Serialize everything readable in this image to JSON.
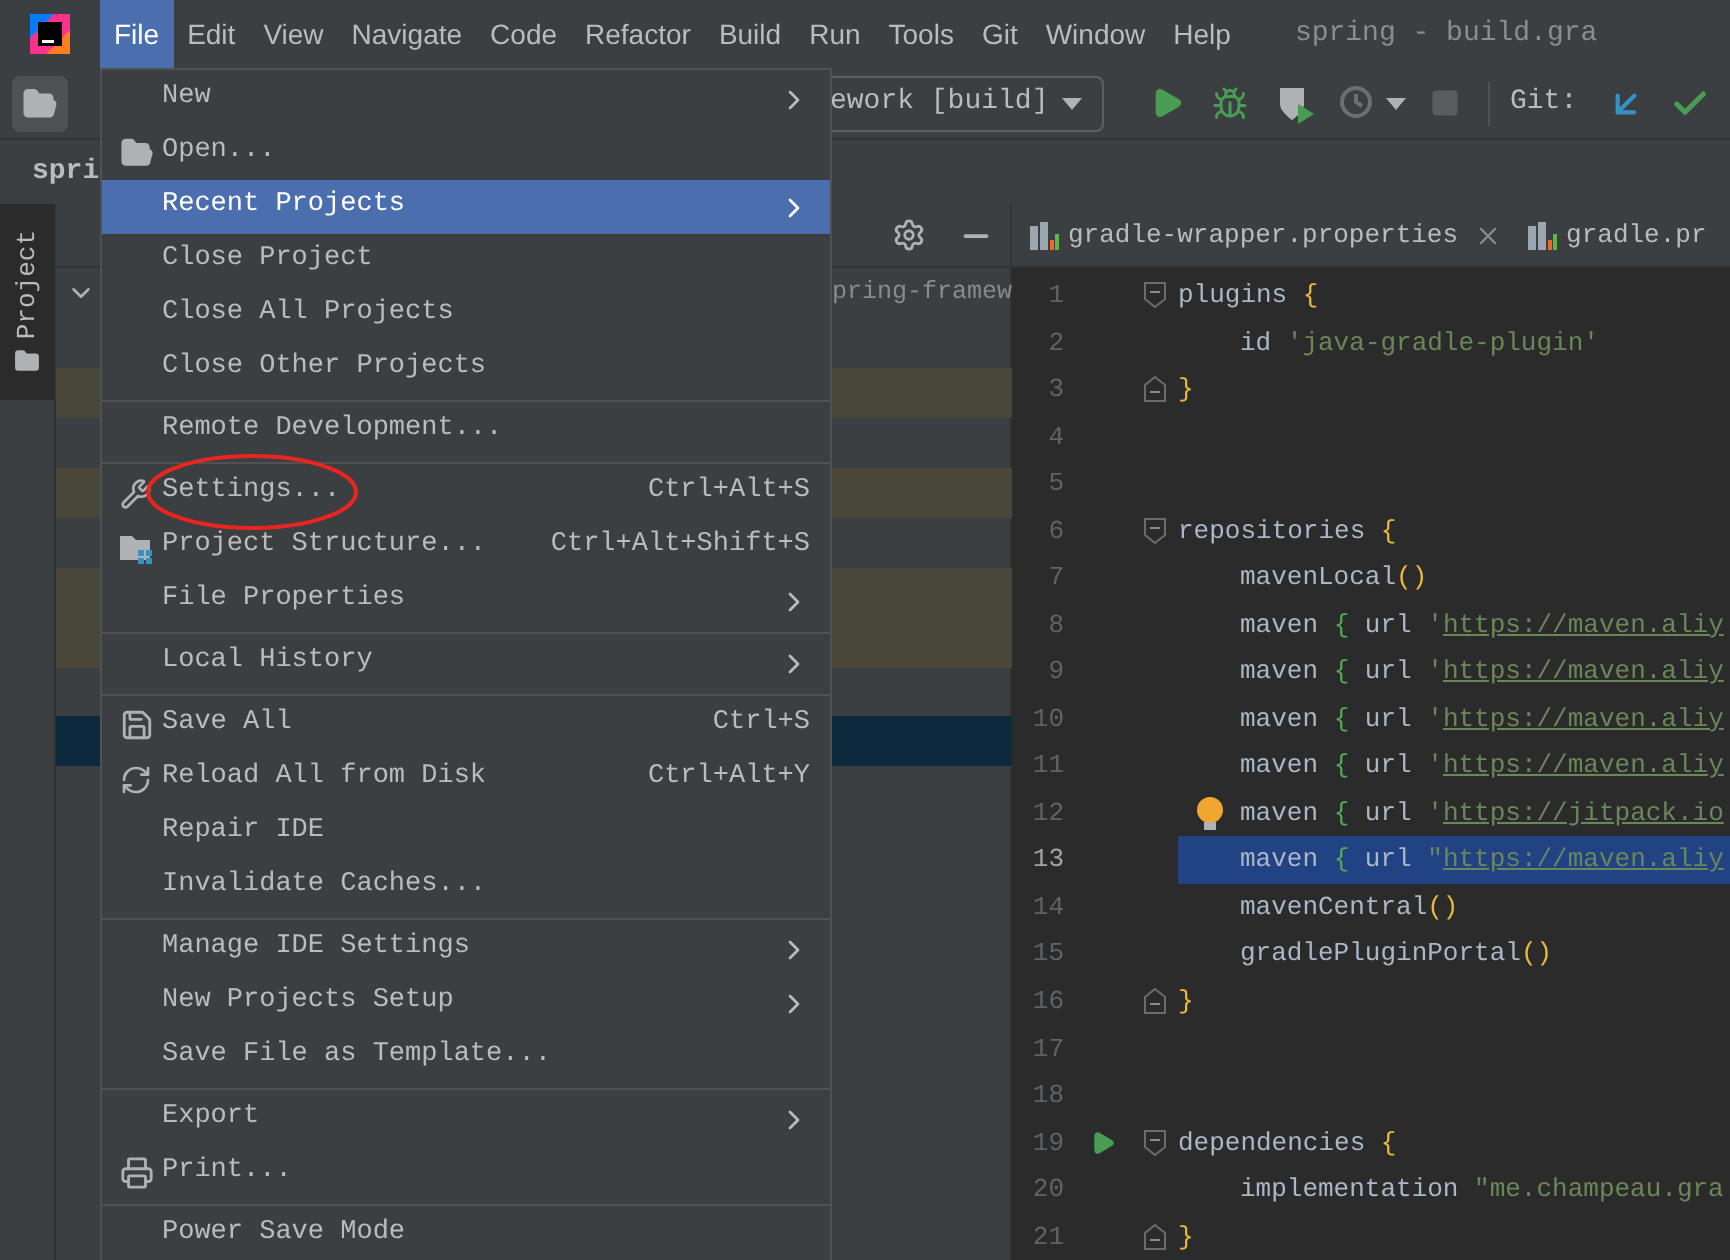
{
  "menubar": {
    "items": [
      {
        "label": "File",
        "selected": true
      },
      {
        "label": "Edit",
        "selected": false
      },
      {
        "label": "View",
        "selected": false
      },
      {
        "label": "Navigate",
        "selected": false
      },
      {
        "label": "Code",
        "selected": false
      },
      {
        "label": "Refactor",
        "selected": false
      },
      {
        "label": "Build",
        "selected": false
      },
      {
        "label": "Run",
        "selected": false
      },
      {
        "label": "Tools",
        "selected": false
      },
      {
        "label": "Git",
        "selected": false
      },
      {
        "label": "Window",
        "selected": false
      },
      {
        "label": "Help",
        "selected": false
      }
    ],
    "title": "spring - build.gra"
  },
  "toolbar": {
    "run_config": "ework [build]",
    "vcs_label": "Git:"
  },
  "nav_bar": {
    "project": "spri"
  },
  "tool_strip": {
    "tab": "Project"
  },
  "project_panel": {
    "path": "pring-framew"
  },
  "editor": {
    "tabs": [
      {
        "label": "gradle-wrapper.properties",
        "selected": false,
        "closable": true
      },
      {
        "label": "gradle.pr",
        "selected": false,
        "closable": false
      }
    ],
    "lines": [
      {
        "number": "1",
        "selected": false,
        "fold_start": true,
        "tokens": [
          {
            "kind": "plain",
            "text": "plugins "
          },
          {
            "kind": "brace",
            "text": "{"
          }
        ]
      },
      {
        "number": "2",
        "selected": false,
        "indented": true,
        "tokens": [
          {
            "kind": "plain",
            "text": "id "
          },
          {
            "kind": "string",
            "text": "'java-gradle-plugin'"
          }
        ]
      },
      {
        "number": "3",
        "selected": false,
        "fold_end": true,
        "tokens": [
          {
            "kind": "brace",
            "text": "}"
          }
        ]
      },
      {
        "number": "4",
        "selected": false
      },
      {
        "number": "5",
        "selected": false
      },
      {
        "number": "6",
        "selected": false,
        "fold_start": true,
        "tokens": [
          {
            "kind": "plain",
            "text": "repositories "
          },
          {
            "kind": "brace",
            "text": "{"
          }
        ]
      },
      {
        "number": "7",
        "selected": false,
        "indented": true,
        "tokens": [
          {
            "kind": "plain",
            "text": "mavenLocal"
          },
          {
            "kind": "brace",
            "text": "()"
          }
        ]
      },
      {
        "number": "8",
        "selected": false,
        "indented": true,
        "tokens": [
          {
            "kind": "plain",
            "text": "maven "
          },
          {
            "kind": "inner-brace",
            "text": "{"
          },
          {
            "kind": "plain",
            "text": " url "
          },
          {
            "kind": "string",
            "text": "'"
          },
          {
            "kind": "link",
            "text": "https://maven.aliy"
          }
        ]
      },
      {
        "number": "9",
        "selected": false,
        "indented": true,
        "tokens": [
          {
            "kind": "plain",
            "text": "maven "
          },
          {
            "kind": "inner-brace",
            "text": "{"
          },
          {
            "kind": "plain",
            "text": " url "
          },
          {
            "kind": "string",
            "text": "'"
          },
          {
            "kind": "link",
            "text": "https://maven.aliy"
          }
        ]
      },
      {
        "number": "10",
        "selected": false,
        "indented": true,
        "tokens": [
          {
            "kind": "plain",
            "text": "maven "
          },
          {
            "kind": "inner-brace",
            "text": "{"
          },
          {
            "kind": "plain",
            "text": " url "
          },
          {
            "kind": "string",
            "text": "'"
          },
          {
            "kind": "link",
            "text": "https://maven.aliy"
          }
        ]
      },
      {
        "number": "11",
        "selected": false,
        "indented": true,
        "tokens": [
          {
            "kind": "plain",
            "text": "maven "
          },
          {
            "kind": "inner-brace",
            "text": "{"
          },
          {
            "kind": "plain",
            "text": " url "
          },
          {
            "kind": "string",
            "text": "'"
          },
          {
            "kind": "link",
            "text": "https://maven.aliy"
          }
        ]
      },
      {
        "number": "12",
        "selected": false,
        "indented": true,
        "bulb": true,
        "tokens": [
          {
            "kind": "plain",
            "text": "maven "
          },
          {
            "kind": "inner-brace",
            "text": "{"
          },
          {
            "kind": "plain",
            "text": " url "
          },
          {
            "kind": "string",
            "text": "'"
          },
          {
            "kind": "link",
            "text": "https://jitpack.io"
          }
        ]
      },
      {
        "number": "13",
        "selected": true,
        "indented": true,
        "tokens": [
          {
            "kind": "plain",
            "text": "maven "
          },
          {
            "kind": "inner-brace",
            "text": "{"
          },
          {
            "kind": "plain",
            "text": " url "
          },
          {
            "kind": "string",
            "text": "\""
          },
          {
            "kind": "link",
            "text": "https://maven.aliy"
          }
        ]
      },
      {
        "number": "14",
        "selected": false,
        "indented": true,
        "tokens": [
          {
            "kind": "plain",
            "text": "mavenCentral"
          },
          {
            "kind": "brace",
            "text": "()"
          }
        ]
      },
      {
        "number": "15",
        "selected": false,
        "indented": true,
        "tokens": [
          {
            "kind": "plain",
            "text": "gradlePluginPortal"
          },
          {
            "kind": "brace",
            "text": "()"
          }
        ]
      },
      {
        "number": "16",
        "selected": false,
        "fold_end": true,
        "tokens": [
          {
            "kind": "brace",
            "text": "}"
          }
        ]
      },
      {
        "number": "17",
        "selected": false
      },
      {
        "number": "18",
        "selected": false
      },
      {
        "number": "19",
        "selected": false,
        "fold_start": true,
        "run_marker": true,
        "tokens": [
          {
            "kind": "plain",
            "text": "dependencies "
          },
          {
            "kind": "brace",
            "text": "{"
          }
        ]
      },
      {
        "number": "20",
        "selected": false,
        "indented": true,
        "tokens": [
          {
            "kind": "plain",
            "text": "implementation "
          },
          {
            "kind": "string",
            "text": "\"me.champeau.gra"
          }
        ]
      },
      {
        "number": "21",
        "selected": false,
        "fold_end": true,
        "tokens": [
          {
            "kind": "brace",
            "text": "}"
          }
        ]
      }
    ]
  },
  "file_menu": {
    "sections": [
      [
        {
          "label": "New",
          "submenu": true,
          "selected": false
        },
        {
          "label": "Open...",
          "kind": "folder",
          "selected": false
        },
        {
          "label": "Recent Projects",
          "submenu": true,
          "selected": true
        },
        {
          "label": "Close Project",
          "selected": false
        },
        {
          "label": "Close All Projects",
          "selected": false
        },
        {
          "label": "Close Other Projects",
          "selected": false
        }
      ],
      [
        {
          "label": "Remote Development...",
          "selected": false
        }
      ],
      [
        {
          "label": "Settings...",
          "kind": "wrench",
          "shortcut": "Ctrl+Alt+S",
          "selected": false
        },
        {
          "label": "Project Structure...",
          "kind": "structure",
          "shortcut": "Ctrl+Alt+Shift+S",
          "selected": false
        },
        {
          "label": "File Properties",
          "submenu": true,
          "selected": false
        }
      ],
      [
        {
          "label": "Local History",
          "submenu": true,
          "selected": false
        }
      ],
      [
        {
          "label": "Save All",
          "kind": "save",
          "shortcut": "Ctrl+S",
          "selected": false
        },
        {
          "label": "Reload All from Disk",
          "kind": "reload",
          "shortcut": "Ctrl+Alt+Y",
          "selected": false
        },
        {
          "label": "Repair IDE",
          "selected": false
        },
        {
          "label": "Invalidate Caches...",
          "selected": false
        }
      ],
      [
        {
          "label": "Manage IDE Settings",
          "submenu": true,
          "selected": false
        },
        {
          "label": "New Projects Setup",
          "submenu": true,
          "selected": false
        },
        {
          "label": "Save File as Template...",
          "selected": false
        }
      ],
      [
        {
          "label": "Export",
          "submenu": true,
          "selected": false
        },
        {
          "label": "Print...",
          "kind": "print",
          "selected": false
        }
      ],
      [
        {
          "label": "Power Save Mode",
          "selected": false
        }
      ]
    ]
  }
}
